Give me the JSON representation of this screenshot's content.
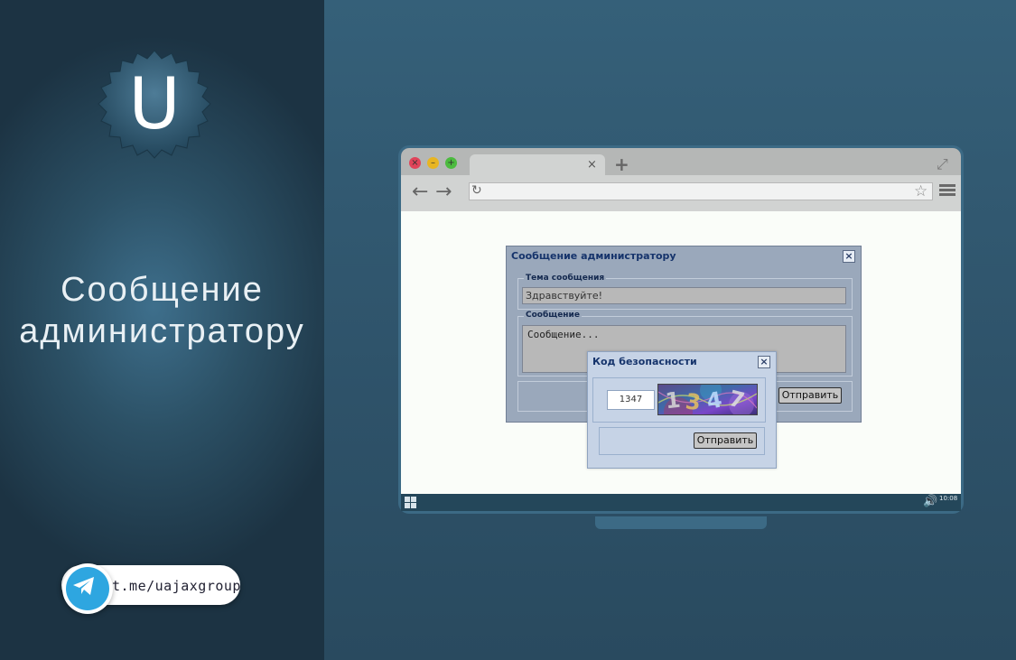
{
  "promo": {
    "logo_letter": "U",
    "title_line1": "Сообщение",
    "title_line2": "администратору",
    "telegram_link": "t.me/uajaxgroup"
  },
  "browser": {
    "tab_close": "×",
    "new_tab": "+",
    "clock": "10:08"
  },
  "admin_dialog": {
    "title": "Сообщение администратору",
    "subject_legend": "Тема сообщения",
    "subject_value": "Здравствуйте!",
    "message_legend": "Сообщение",
    "message_value": "Сообщение...",
    "submit_label": "Отправить"
  },
  "captcha_dialog": {
    "title": "Код безопасности",
    "code_value": "1347",
    "submit_label": "Отправить"
  },
  "colors": {
    "telegram": "#2ea6e0",
    "dialog_title": "#15336b"
  }
}
